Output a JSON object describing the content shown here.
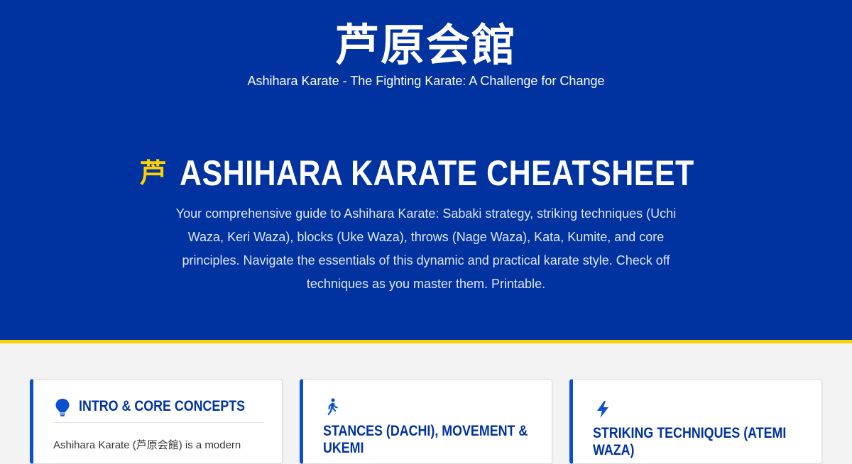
{
  "header": {
    "site_title": "芦原会館",
    "site_subtitle": "Ashihara Karate - The Fighting Karate: A Challenge for Change"
  },
  "hero": {
    "title_icon": "芦",
    "title": "ASHIHARA KARATE CHEATSHEET",
    "description": "Your comprehensive guide to Ashihara Karate: Sabaki strategy, striking techniques (Uchi Waza, Keri Waza), blocks (Uke Waza), throws (Nage Waza), Kata, Kumite, and core principles. Navigate the essentials of this dynamic and practical karate style. Check off techniques as you master them. Printable."
  },
  "cards": [
    {
      "icon": "lightbulb-icon",
      "title": "INTRO & CORE CONCEPTS",
      "body": "Ashihara Karate (芦原会館) is a modern"
    },
    {
      "icon": "walking-person-icon",
      "title_line1": "STANCES (DACHI), MOVEMENT &",
      "title_line2": "UKEMI"
    },
    {
      "icon": "lightning-bolt-icon",
      "title_line1": "STRIKING TECHNIQUES (ATEMI",
      "title_line2": "WAZA)"
    }
  ],
  "colors": {
    "hero_background": "#0033a0",
    "accent_yellow": "#ffd100",
    "card_accent": "#0b4fcf",
    "page_background": "#f3f3f3"
  }
}
